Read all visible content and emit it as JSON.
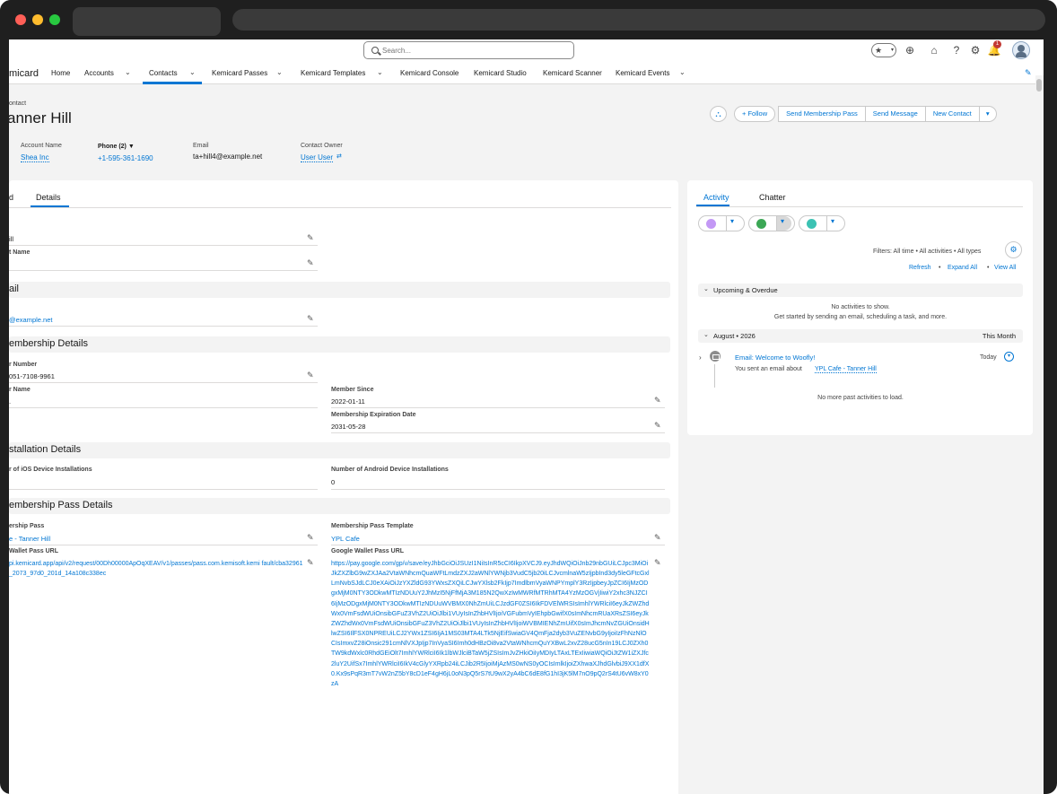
{
  "search": {
    "placeholder": "Search..."
  },
  "header": {
    "notification_count": "1"
  },
  "nav": {
    "app_name": "micard",
    "items": [
      "Home",
      "Accounts",
      "Contacts",
      "Kemicard Passes",
      "Kemicard Templates",
      "Kemicard Console",
      "Kemicard Studio",
      "Kemicard Scanner",
      "Kemicard Events"
    ]
  },
  "record": {
    "type": "ontact",
    "title": "anner Hill",
    "buttons": {
      "follow": "+ Follow",
      "send_pass": "Send Membership Pass",
      "send_message": "Send Message",
      "new_contact": "New Contact"
    }
  },
  "highlights": {
    "account_name_label": "Account Name",
    "account_name": "Shea Inc",
    "phone_label": "Phone (2) ▼",
    "phone": "+1-595-361-1690",
    "email_label": "Email",
    "email": "ta+hill4@example.net",
    "owner_label": "Contact Owner",
    "owner": "User User"
  },
  "tabs": {
    "left_partial": "d",
    "details": "Details"
  },
  "details": {
    "f1_value": "ill",
    "f2_label": "t Name",
    "f2_value": "",
    "section_email": "ail",
    "email_value": "@example.net",
    "section_membership": "embership Details",
    "member_number_label": "r Number",
    "member_number": "051-7108-9961",
    "member_name_label": "r Name",
    "member_name": ".",
    "member_since_label": "Member Since",
    "member_since": "2022-01-11",
    "expiration_label": "Membership Expiration Date",
    "expiration": "2031-05-28",
    "section_installation": "stallation Details",
    "ios_label": "r of iOS Device Installations",
    "ios_value": "",
    "android_label": "Number of Android Device Installations",
    "android_value": "0",
    "section_pass": "embership Pass Details",
    "pass_label": "ership Pass",
    "pass_value": "e - Tanner Hill",
    "template_label": "Membership Pass Template",
    "template_value": "YPL Cafe",
    "wallet_label": "Wallet Pass URL",
    "wallet_value": "pi.kemicard.app/api/v2/request/00Dh00000ApOqXEAV/v1/passes/pass.com.kemisoft.kemi fault/cba32961_2073_97d0_201d_14a108c338ec",
    "google_label": "Google Wallet Pass URL",
    "google_value": "https://pay.google.com/gp/v/save/eyJhbGciOiJSUzI1NiIsInR5cCI6IkpXVCJ9.eyJhdWQiOiJnb29nbGUiLCJpc3MiOiJkZXZlbG9wZXJAa2VtaWNhcmQuaWFtLmdzZXJ2aWNlYWNjb3VudC5jb20iLCJvcmlnaW5zIjpbInd3dy5leGFtcGxlLmNvbSJdLCJ0eXAiOiJzYXZldG93YWxsZXQiLCJwYXlsb2FkIjp7ImdlbmVyaWNPYmplY3RzIjpbeyJpZCI6IjMzODgxMjM0NTY3ODkwMTIzNDUuY2JhMzI5NjFfMjA3M185N2QwXzIwMWRfMTRhMTA4YzMzOGVjIiwiY2xhc3NJZCI6IjMzODgxMjM0NTY3ODkwMTIzNDUuWVBMX0NhZmUiLCJzdGF0ZSI6IkFDVElWRSIsImhlYWRlciI6eyJkZWZhdWx0VmFsdWUiOnsibGFuZ3VhZ2UiOiJlbi1VUyIsInZhbHVlIjoiVGFubmVyIEhpbGwifX0sImNhcmRUaXRsZSI6eyJkZWZhdWx0VmFsdWUiOnsibGFuZ3VhZ2UiOiJlbi1VUyIsInZhbHVlIjoiWVBMIENhZmUifX0sImJhcmNvZGUiOnsidHlwZSI6IlFSX0NPREUiLCJ2YWx1ZSI6IjA1MS03MTA4LTk5NjEifSwiaGV4QmFja2dyb3VuZENvbG9yIjoiIzFhNzNlOCIsImxvZ28iOnsic291cmNlVXJpIjp7InVyaSI6Imh0dHBzOi8va2VtaWNhcmQuYXBwL2xvZ28ucG5nIn19LCJ0ZXh0TW9kdWxlc0RhdGEiOlt7ImhlYWRlciI6Ik1lbWJlciBTaW5jZSIsImJvZHkiOiIyMDIyLTAxLTExIiwiaWQiOiJtZW1iZXJfc2luY2UifSx7ImhlYWRlciI6IkV4cGlyYXRpb24iLCJib2R5IjoiMjAzMS0wNS0yOCIsImlkIjoiZXhwaXJhdGlvbiJ9XX1dfX0.Kx9sPqR3mT7vW2nZ5bY8cD1eF4gH6jL0oN3pQ5rS7tU9wX2yA4bC6dE8fG1hI3jK5lM7nO9pQ2rS4tU6vW8xY0zA"
  },
  "activity": {
    "tab_activity": "Activity",
    "tab_chatter": "Chatter",
    "filters": "Filters: All time • All activities • All types",
    "refresh": "Refresh",
    "expand_all": "Expand All",
    "view_all": "View All",
    "upcoming": "Upcoming & Overdue",
    "no_activities": "No activities to show.",
    "get_started": "Get started by sending an email, scheduling a task, and more.",
    "month": "August • 2026",
    "this_month": "This Month",
    "email_subject": "Email: Welcome to Woofly!",
    "email_date": "Today",
    "email_desc": "You sent an email about",
    "email_link": "YPL Cafe - Tanner Hill",
    "no_more": "No more past activities to load."
  }
}
